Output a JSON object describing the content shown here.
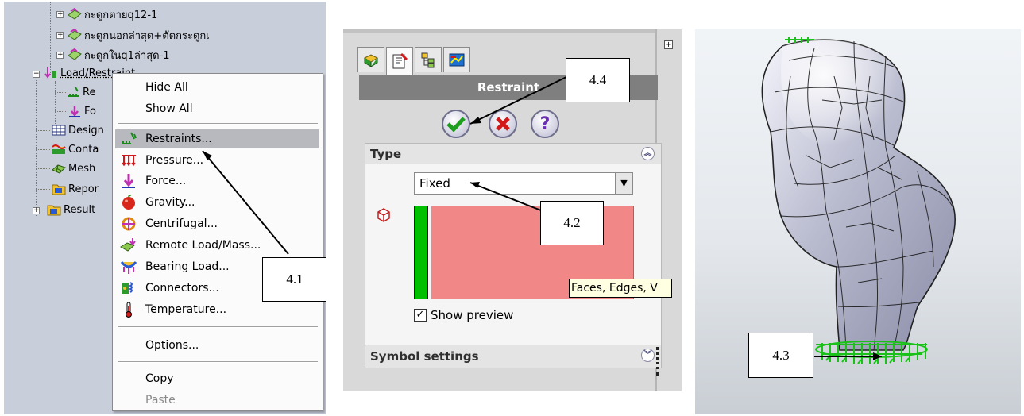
{
  "tree": {
    "items": [
      {
        "label": "กะดูกตายq12-1"
      },
      {
        "label": "กะดูกนอกล่าสุด+ตัดกระดูกเ"
      },
      {
        "label": "กะดูกในq1ล่าสุด-1"
      },
      {
        "label": "Load/Restraint"
      },
      {
        "label": "Re"
      },
      {
        "label": "Fo"
      },
      {
        "label": "Design"
      },
      {
        "label": "Conta"
      },
      {
        "label": "Mesh"
      },
      {
        "label": "Repor"
      },
      {
        "label": "Result"
      }
    ]
  },
  "context_menu": {
    "items": [
      {
        "label": "Hide All",
        "icon": "none"
      },
      {
        "label": "Show All",
        "icon": "none"
      },
      {
        "label": "Restraints...",
        "icon": "restraint-icon",
        "selected": true
      },
      {
        "label": "Pressure...",
        "icon": "pressure-icon"
      },
      {
        "label": "Force...",
        "icon": "force-icon"
      },
      {
        "label": "Gravity...",
        "icon": "gravity-icon"
      },
      {
        "label": "Centrifugal...",
        "icon": "centrifugal-icon"
      },
      {
        "label": "Remote Load/Mass...",
        "icon": "remote-load-icon"
      },
      {
        "label": "Bearing Load...",
        "icon": "bearing-load-icon"
      },
      {
        "label": "Connectors...",
        "icon": "connectors-icon"
      },
      {
        "label": "Temperature...",
        "icon": "temperature-icon"
      },
      {
        "label": "Options...",
        "icon": "none"
      },
      {
        "label": "Copy",
        "icon": "none"
      },
      {
        "label": "Paste",
        "icon": "none",
        "disabled": true
      }
    ]
  },
  "callouts": {
    "c41": "4.1",
    "c42": "4.2",
    "c43": "4.3",
    "c44": "4.4"
  },
  "property_manager": {
    "title": "Restraint",
    "type_group": "Type",
    "type_value": "Fixed",
    "tooltip": "Faces, Edges, V",
    "show_preview": "Show preview",
    "symbol_group": "Symbol settings"
  },
  "colors": {
    "tree_bg": "#c9cedb",
    "selection_box": "#f28787",
    "green_bar": "#00c000",
    "ok_green": "#1e9e1e",
    "cancel_red": "#d11919",
    "help_purple": "#6a2fb5",
    "mesh_surface": "#a9abbf"
  }
}
